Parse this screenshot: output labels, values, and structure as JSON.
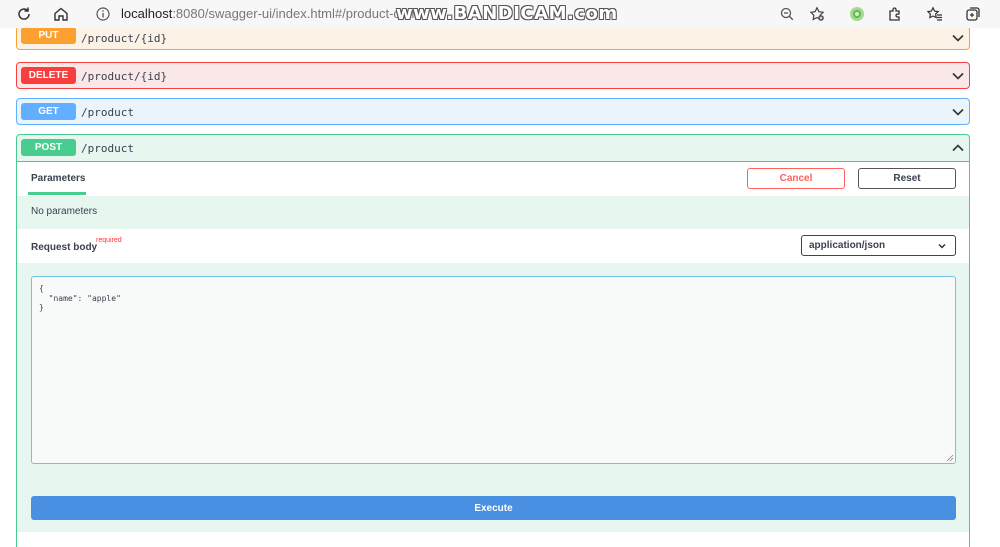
{
  "browser": {
    "url_host": "localhost",
    "url_path": ":8080/swagger-ui/index.html#/product-con",
    "watermark": "www.BANDICAM.com",
    "icons": [
      "refresh-icon",
      "home-icon",
      "info-icon",
      "zoom-out-icon",
      "favorite-add-icon",
      "extension-green-icon",
      "extensions-icon",
      "favorites-icon",
      "collections-icon"
    ]
  },
  "operations": [
    {
      "method": "PUT",
      "path": "/product/{id}",
      "color": "#fca130",
      "expanded": false
    },
    {
      "method": "DELETE",
      "path": "/product/{id}",
      "color": "#f93e3e",
      "expanded": false
    },
    {
      "method": "GET",
      "path": "/product",
      "color": "#61affe",
      "expanded": false
    },
    {
      "method": "POST",
      "path": "/product",
      "color": "#49cc90",
      "expanded": true
    }
  ],
  "post_panel": {
    "parameters_tab": "Parameters",
    "cancel_label": "Cancel",
    "reset_label": "Reset",
    "no_parameters": "No parameters",
    "request_body_label": "Request body",
    "required_label": "required",
    "content_type": "application/json",
    "body_lines": [
      "{",
      "  \"name\": \"apple\"",
      "}"
    ],
    "execute_label": "Execute"
  }
}
